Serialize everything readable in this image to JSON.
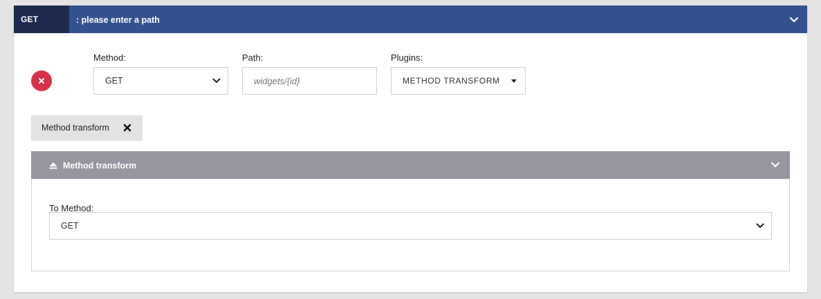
{
  "header": {
    "method_badge": "GET",
    "title": ": please enter a path"
  },
  "form": {
    "method": {
      "label": "Method:",
      "value": "GET"
    },
    "path": {
      "label": "Path:",
      "placeholder": "widgets/{id}",
      "value": ""
    },
    "plugins": {
      "label": "Plugins:",
      "value": "METHOD TRANSFORM"
    }
  },
  "tag": {
    "label": "Method transform"
  },
  "plugin_panel": {
    "title": "Method transform",
    "to_method": {
      "label": "To Method:",
      "value": "GET"
    }
  },
  "icons": {
    "header_chevron": "chevron-down-icon",
    "remove": "close-icon",
    "tag_close": "close-icon",
    "panel_eject": "eject-icon",
    "panel_chevron": "chevron-down-icon"
  },
  "colors": {
    "header_bg": "#33528f",
    "badge_bg": "#1d2b4e",
    "remove_btn": "#d9304a",
    "panel_header_bg": "#9596a0",
    "tag_bg": "#e3e3e3"
  }
}
